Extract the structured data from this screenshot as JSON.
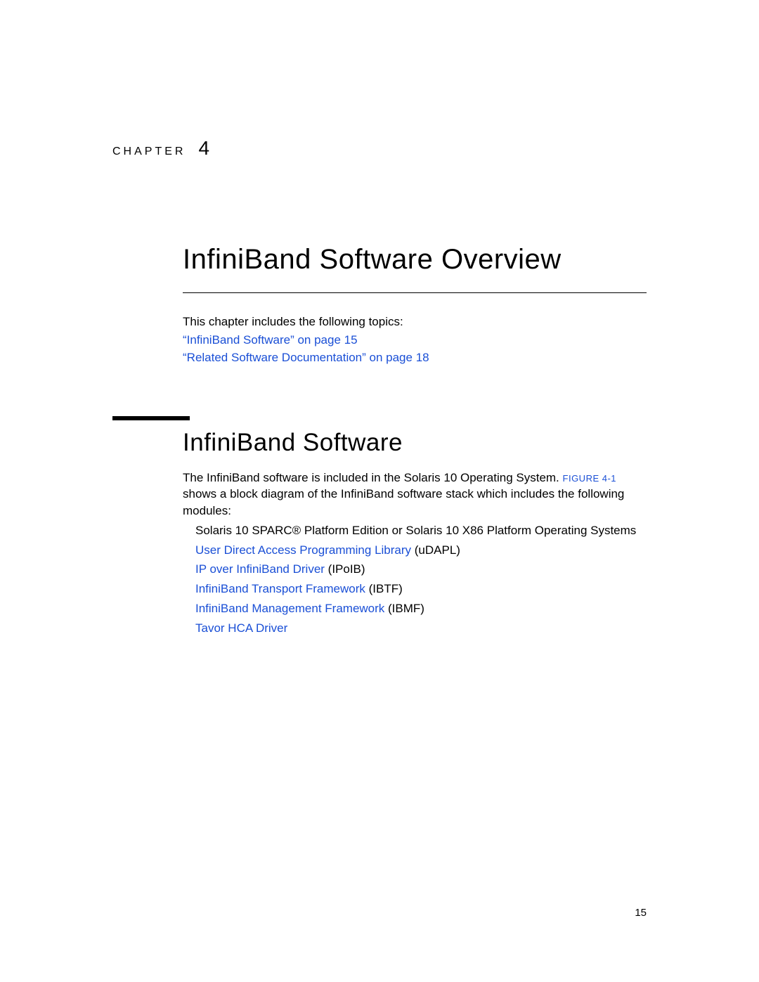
{
  "chapter": {
    "label": "CHAPTER",
    "number": "4"
  },
  "title": "InfiniBand Software Overview",
  "intro": {
    "lead": "This chapter includes the following topics:",
    "links": [
      "“InfiniBand Software” on page 15",
      "“Related Software Documentation” on page 18"
    ]
  },
  "section": {
    "heading": "InfiniBand Software",
    "p1_a": "The InfiniBand software is included in the Solaris 10 Operating System. ",
    "fig_ref": "FIGURE 4-1",
    "p1_b": " shows a block diagram of the InfiniBand software stack which includes the following modules:",
    "modules": {
      "os": "Solaris 10 SPARC® Platform Edition or Solaris 10 X86 Platform Operating Systems",
      "udapl_link": "User Direct Access Programming Library",
      "udapl_tail": " (uDAPL)",
      "ipoib_link": "IP over InfiniBand Driver",
      "ipoib_tail": " (IPoIB)",
      "ibtf_link": "InfiniBand Transport Framework",
      "ibtf_tail": " (IBTF)",
      "ibmf_link": "InfiniBand Management Framework",
      "ibmf_tail": " (IBMF)",
      "tavor_link": "Tavor HCA Driver"
    }
  },
  "page_number": "15"
}
